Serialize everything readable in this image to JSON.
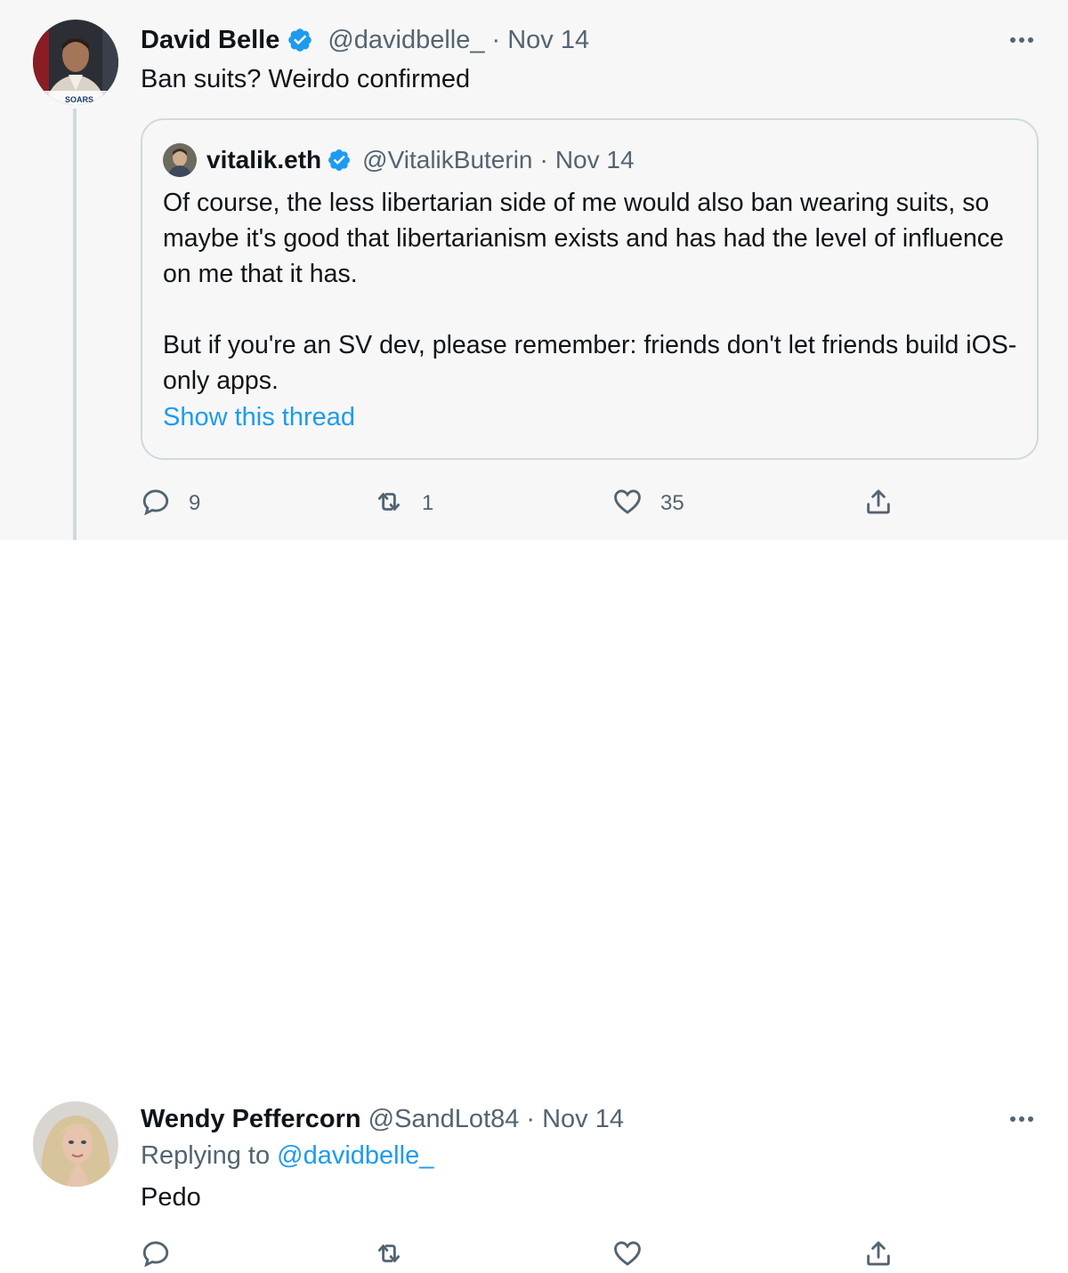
{
  "tweets": [
    {
      "author_name": "David Belle",
      "handle": "@davidbelle_",
      "separator": "·",
      "date": "Nov 14",
      "text": "Ban suits? Weirdo confirmed",
      "verified": true,
      "avatar_caption": "SOARS",
      "quote": {
        "author_name": "vitalik.eth",
        "handle": "@VitalikButerin",
        "separator": "·",
        "date": "Nov 14",
        "verified": true,
        "text": "Of course, the less libertarian side of me would also ban wearing suits, so maybe it's good that libertarianism exists and has had the level of influence on me that it has.\n\nBut if you're an SV dev, please remember: friends don't let friends build iOS-only apps.",
        "show_thread": "Show this thread"
      },
      "actions": {
        "reply_count": "9",
        "retweet_count": "1",
        "like_count": "35"
      }
    },
    {
      "author_name": "Wendy Peffercorn",
      "handle": "@SandLot84",
      "separator": "·",
      "date": "Nov 14",
      "replying_prefix": "Replying to",
      "replying_to": "@davidbelle_",
      "text": "Pedo"
    }
  ],
  "colors": {
    "accent": "#1d9bf0",
    "secondary_text": "#536471",
    "primary_text": "#0f1419",
    "highlight_bg": "#f7f7f7",
    "border": "#cfd9de"
  },
  "icons": [
    "verified-badge-icon",
    "more-icon",
    "reply-icon",
    "retweet-icon",
    "like-icon",
    "share-icon"
  ]
}
